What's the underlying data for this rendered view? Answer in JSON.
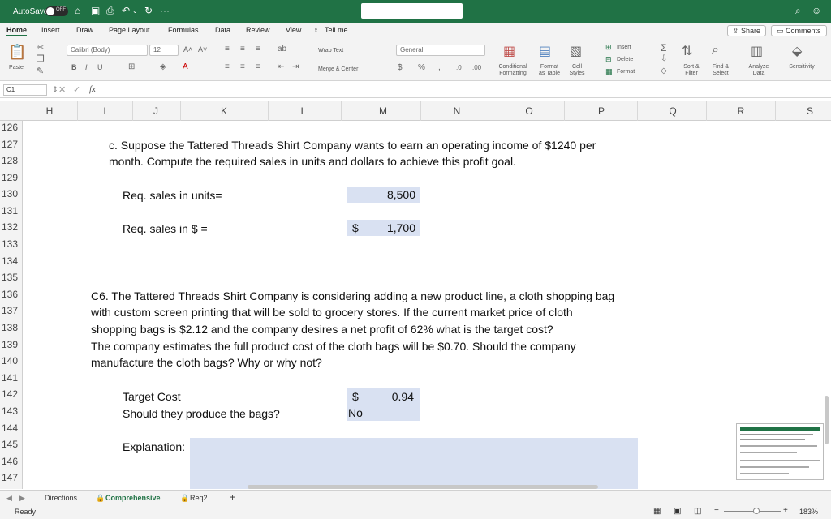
{
  "titlebar": {
    "autosave_label": "AutoSave",
    "autosave_state": "OFF",
    "more": "···"
  },
  "tabs": {
    "items": [
      "Home",
      "Insert",
      "Draw",
      "Page Layout",
      "Formulas",
      "Data",
      "Review",
      "View"
    ],
    "tell_me": "Tell me",
    "share": "Share",
    "comments": "Comments"
  },
  "ribbon": {
    "paste": "Paste",
    "font_name": "Calibri (Body)",
    "font_size": "12",
    "wrap_text": "Wrap Text",
    "merge_center": "Merge & Center",
    "number_format": "General",
    "conditional": [
      "Conditional",
      "Formatting"
    ],
    "format_table": [
      "Format",
      "as Table"
    ],
    "cell_styles": [
      "Cell",
      "Styles"
    ],
    "insert": "Insert",
    "delete": "Delete",
    "format": "Format",
    "sort_filter": [
      "Sort &",
      "Filter"
    ],
    "find_select": [
      "Find &",
      "Select"
    ],
    "analyze": [
      "Analyze",
      "Data"
    ],
    "sensitivity": "Sensitivity"
  },
  "formula_bar": {
    "cell_ref": "C1",
    "fx": "fx",
    "formula": ""
  },
  "columns": [
    "H",
    "I",
    "J",
    "K",
    "L",
    "M",
    "N",
    "O",
    "P",
    "Q",
    "R",
    "S"
  ],
  "rows": [
    "126",
    "127",
    "128",
    "129",
    "130",
    "131",
    "132",
    "133",
    "134",
    "135",
    "136",
    "137",
    "138",
    "139",
    "140",
    "141",
    "142",
    "143",
    "144",
    "145",
    "146",
    "147"
  ],
  "sheet": {
    "q_c_line1": "c. Suppose the Tattered Threads Shirt Company wants to earn an operating income of $1240 per",
    "q_c_line2": "month. Compute the required sales in units and dollars to achieve this profit goal.",
    "req_units_label": "Req. sales in units=",
    "req_units_value": "8,500",
    "req_dollars_label": "Req. sales in $ =",
    "req_dollars_symbol": "$",
    "req_dollars_value": "1,700",
    "c6_line1": "C6. The Tattered Threads Shirt Company is considering adding a new product line, a cloth shopping bag",
    "c6_line2": "with custom screen printing that will be sold to grocery stores. If the current market price of cloth",
    "c6_line3": "shopping bags is $2.12 and the company desires a net profit of 62% what is the target cost?",
    "c6_line4": "The company estimates the full product cost of the cloth bags will be $0.70. Should the company",
    "c6_line5": "manufacture the cloth bags? Why or why not?",
    "target_cost_label": "Target Cost",
    "target_cost_symbol": "$",
    "target_cost_value": "0.94",
    "produce_label": "Should they produce the bags?",
    "produce_value": "No",
    "explanation_label": "Explanation:"
  },
  "sheet_tabs": [
    "Directions",
    "Comprehensive",
    "Req2"
  ],
  "status": {
    "ready": "Ready",
    "zoom": "183%"
  },
  "colors": {
    "accent": "#207245",
    "input_fill": "#d9e1f2"
  }
}
